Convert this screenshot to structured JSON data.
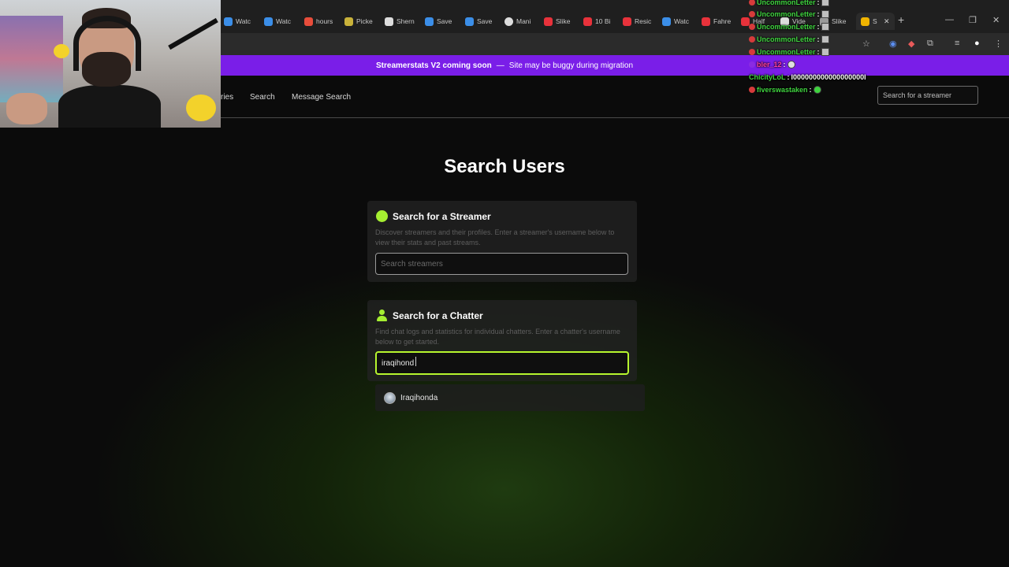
{
  "browser": {
    "tabs": [
      {
        "label": "Watc",
        "icon": "tab-favicon",
        "color": "#3b8ee8"
      },
      {
        "label": "Watc",
        "icon": "tab-favicon",
        "color": "#3b8ee8"
      },
      {
        "label": "hours",
        "icon": "tab-favicon",
        "color": "#e84d3b"
      },
      {
        "label": "Picke",
        "icon": "tab-favicon",
        "color": "#c9b23a"
      },
      {
        "label": "Shern",
        "icon": "x-icon",
        "color": "#dddddd"
      },
      {
        "label": "Save",
        "icon": "tab-favicon",
        "color": "#3b8ee8"
      },
      {
        "label": "Save",
        "icon": "tab-favicon",
        "color": "#3b8ee8"
      },
      {
        "label": "Mani",
        "icon": "google-icon",
        "color": "#dddddd"
      },
      {
        "label": "Slike",
        "icon": "youtube-icon",
        "color": "#e8323b"
      },
      {
        "label": "10 Bi",
        "icon": "youtube-icon",
        "color": "#e8323b"
      },
      {
        "label": "Resic",
        "icon": "youtube-icon",
        "color": "#e8323b"
      },
      {
        "label": "Watc",
        "icon": "tab-favicon",
        "color": "#3b8ee8"
      },
      {
        "label": "Fahre",
        "icon": "youtube-icon",
        "color": "#e8323b"
      },
      {
        "label": "Half",
        "icon": "youtube-icon",
        "color": "#e8323b"
      },
      {
        "label": "Vide",
        "icon": "x-icon",
        "color": "#dddddd"
      },
      {
        "label": "Slike",
        "icon": "tab-favicon",
        "color": "#9a9a9a"
      },
      {
        "label": "S",
        "icon": "chart-icon",
        "color": "#f0b400",
        "active": true
      }
    ],
    "new_tab": "+",
    "close_tab": "✕",
    "window": {
      "minimize": "—",
      "maximize": "❐",
      "close": "✕"
    }
  },
  "banner": {
    "title": "Streamerstats V2 coming soon",
    "separator": "—",
    "message": "Site may be buggy during migration",
    "color": "#7a1ee8"
  },
  "header": {
    "nav": [
      "ries",
      "Search",
      "Message Search"
    ],
    "search_placeholder": "Search for a streamer"
  },
  "page": {
    "title": "Search Users",
    "streamer_card": {
      "heading": "Search for a Streamer",
      "description": "Discover streamers and their profiles. Enter a streamer's username below to view their stats and past streams.",
      "placeholder": "Search streamers",
      "icon": "green-dot-icon"
    },
    "chatter_card": {
      "heading": "Search for a Chatter",
      "description": "Find chat logs and statistics for individual chatters. Enter a chatter's username below to get started.",
      "value": "iraqihond",
      "icon": "user-icon"
    },
    "suggestion": {
      "name": "Iraqihonda"
    },
    "accent": "#a5ee31"
  },
  "chat": [
    {
      "user": "UncommonLetter",
      "sep": ":",
      "msg": "",
      "color": "#3fd33f"
    },
    {
      "user": "UncommonLetter",
      "sep": ":",
      "msg": "",
      "color": "#3fd33f"
    },
    {
      "user": "UncommonLetter",
      "sep": ":",
      "msg": "",
      "color": "#3fd33f"
    },
    {
      "user": "UncommonLetter",
      "sep": ":",
      "msg": "",
      "color": "#3fd33f"
    },
    {
      "user": "UncommonLetter",
      "sep": ":",
      "msg": "",
      "color": "#3fd33f"
    },
    {
      "user": "bler_12",
      "sep": ":",
      "msg": "",
      "color": "#ff3fa0"
    },
    {
      "user": "ChicityLoL",
      "sep": ":",
      "msg": "l000000000000000000l",
      "color": "#3fd33f"
    },
    {
      "user": "fiverswastaken",
      "sep": ":",
      "msg": "",
      "color": "#3fd33f"
    }
  ]
}
